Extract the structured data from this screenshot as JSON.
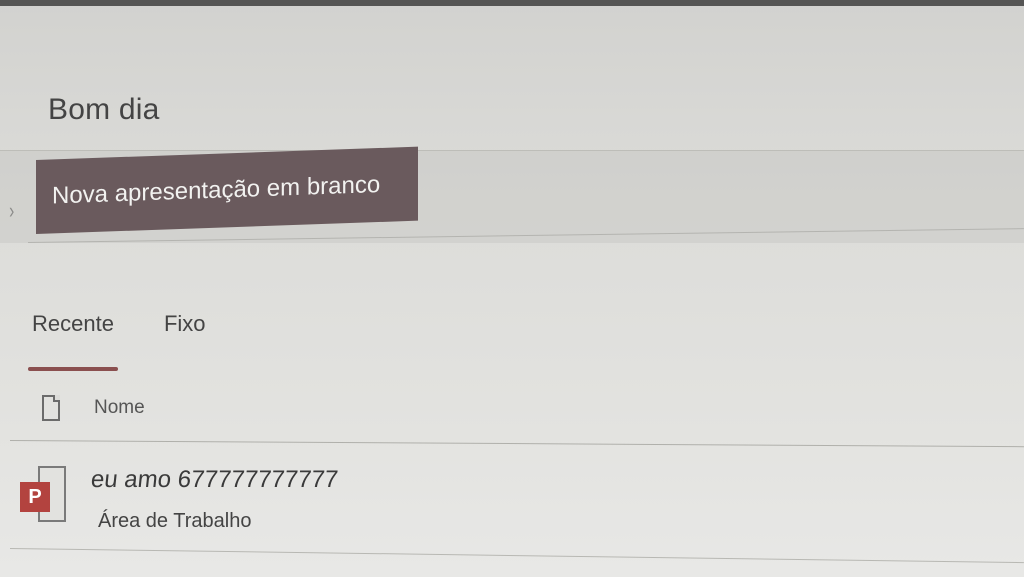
{
  "greeting": "Bom dia",
  "new_presentation": {
    "label": "Nova apresentação em branco"
  },
  "tabs": [
    {
      "label": "Recente",
      "active": true
    },
    {
      "label": "Fixo",
      "active": false
    }
  ],
  "file_list": {
    "column_header": "Nome",
    "files": [
      {
        "name": "eu amo 677777777777",
        "location": "Área de Trabalho",
        "icon": "powerpoint-file-icon",
        "app_badge": "P"
      }
    ]
  },
  "colors": {
    "new_button_bg": "#6a5a5d",
    "active_tab_underline": "#8a4f4f",
    "ppt_badge": "#b3433f"
  }
}
